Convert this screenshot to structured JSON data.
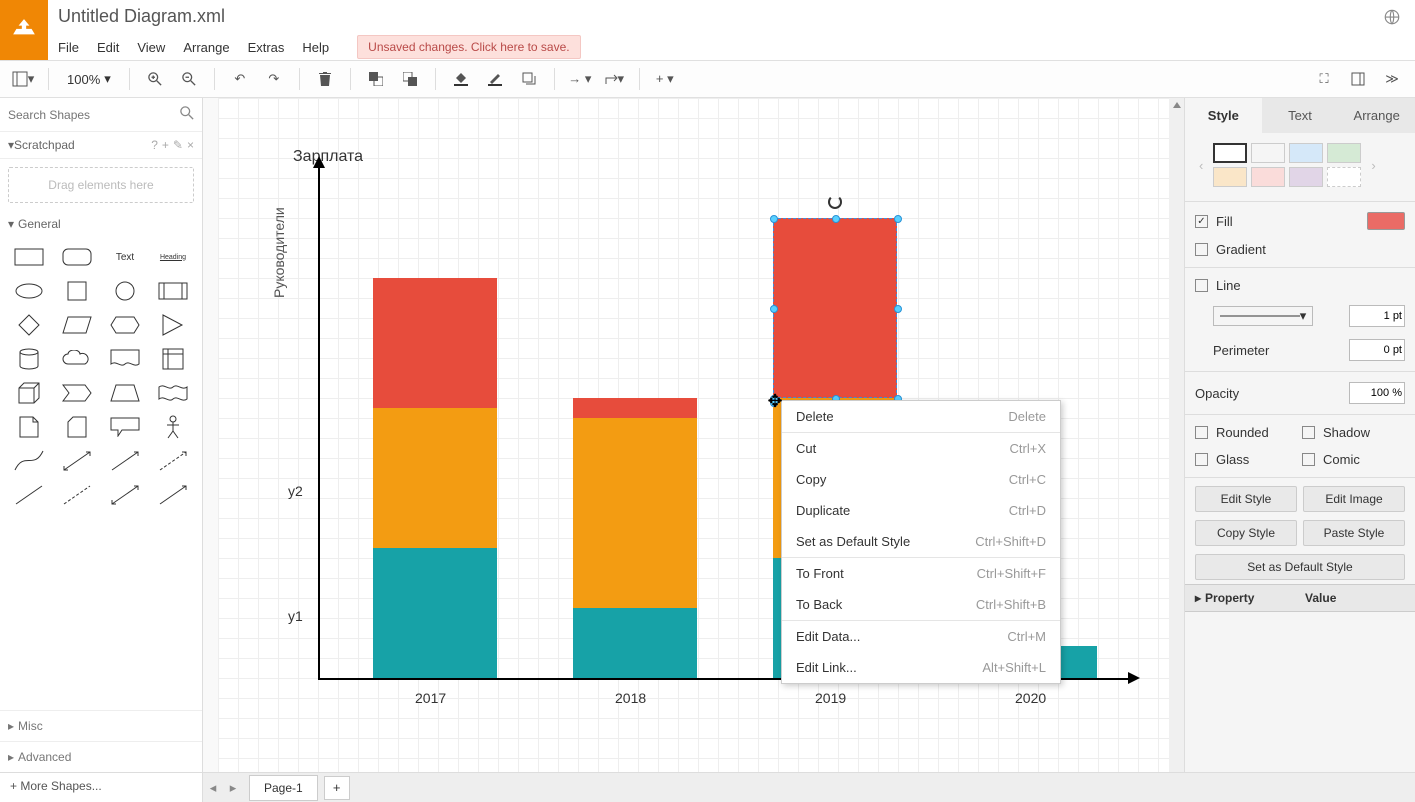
{
  "title": "Untitled Diagram.xml",
  "menus": [
    "File",
    "Edit",
    "View",
    "Arrange",
    "Extras",
    "Help"
  ],
  "unsaved": "Unsaved changes. Click here to save.",
  "zoom": "100%",
  "left": {
    "search_ph": "Search Shapes",
    "scratchpad": "Scratchpad",
    "drag_hint": "Drag elements here",
    "general": "General",
    "misc": "Misc",
    "advanced": "Advanced",
    "more": "+  More Shapes...",
    "text_shape": "Text",
    "heading_shape": "Heading"
  },
  "right": {
    "tabs": [
      "Style",
      "Text",
      "Arrange"
    ],
    "fill": "Fill",
    "gradient": "Gradient",
    "line": "Line",
    "pt": "1 pt",
    "perimeter": "Perimeter",
    "perimeter_val": "0 pt",
    "opacity": "Opacity",
    "opacity_val": "100 %",
    "rounded": "Rounded",
    "shadow": "Shadow",
    "glass": "Glass",
    "comic": "Comic",
    "edit_style": "Edit Style",
    "edit_image": "Edit Image",
    "copy_style": "Copy Style",
    "paste_style": "Paste Style",
    "set_default": "Set as Default Style",
    "property": "Property",
    "value": "Value",
    "colors": {
      "fill_current": "#ea6b66",
      "swatches": [
        "#ffffff",
        "#f5f5f5",
        "#d5e8f9",
        "#d5ead5",
        "#fae6c8",
        "#fadcda",
        "#e1d5e7"
      ]
    }
  },
  "page": {
    "tab": "Page-1",
    "add": "+"
  },
  "ctx": {
    "items": [
      {
        "l": "Delete",
        "s": "Delete"
      },
      {
        "sep": true
      },
      {
        "l": "Cut",
        "s": "Ctrl+X"
      },
      {
        "l": "Copy",
        "s": "Ctrl+C"
      },
      {
        "l": "Duplicate",
        "s": "Ctrl+D"
      },
      {
        "l": "Set as Default Style",
        "s": "Ctrl+Shift+D"
      },
      {
        "sep": true
      },
      {
        "l": "To Front",
        "s": "Ctrl+Shift+F"
      },
      {
        "l": "To Back",
        "s": "Ctrl+Shift+B"
      },
      {
        "sep": true
      },
      {
        "l": "Edit Data...",
        "s": "Ctrl+M"
      },
      {
        "l": "Edit Link...",
        "s": "Alt+Shift+L"
      }
    ]
  },
  "chart_data": {
    "type": "bar",
    "title": "Зарплата",
    "ylabel_side": "Руководители",
    "y_ticks": [
      "y1",
      "y2"
    ],
    "categories": [
      "2017",
      "2018",
      "2019",
      "2020"
    ],
    "series": [
      {
        "name": "teal",
        "color": "#17a2a7",
        "values": [
          130,
          70,
          120,
          32
        ]
      },
      {
        "name": "orange",
        "color": "#f39c12",
        "values": [
          140,
          190,
          160,
          0
        ]
      },
      {
        "name": "red",
        "color": "#e74c3c",
        "values": [
          130,
          20,
          180,
          0
        ]
      }
    ],
    "stacked": true,
    "selected_bar_index": 2,
    "selected_series_index": 2
  }
}
